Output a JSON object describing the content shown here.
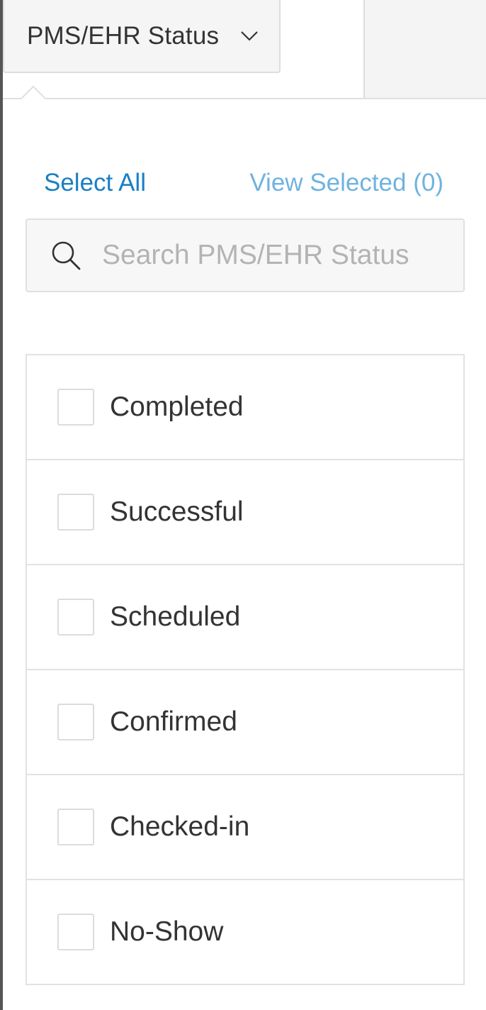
{
  "filter": {
    "trigger_label": "PMS/EHR Status",
    "trigger_icon": "chevron-down-icon"
  },
  "popover": {
    "select_all_label": "Select All",
    "view_selected_label": "View Selected (0)",
    "search": {
      "value": "",
      "placeholder": "Search PMS/EHR Status",
      "icon": "search-icon"
    },
    "options": [
      {
        "label": "Completed",
        "checked": false
      },
      {
        "label": "Successful",
        "checked": false
      },
      {
        "label": "Scheduled",
        "checked": false
      },
      {
        "label": "Confirmed",
        "checked": false
      },
      {
        "label": "Checked-in",
        "checked": false
      },
      {
        "label": "No-Show",
        "checked": false
      }
    ]
  },
  "colors": {
    "link": "#1a7fc4",
    "link_muted": "#6fb3e0",
    "text": "#333333",
    "placeholder": "#b3b3b3"
  }
}
